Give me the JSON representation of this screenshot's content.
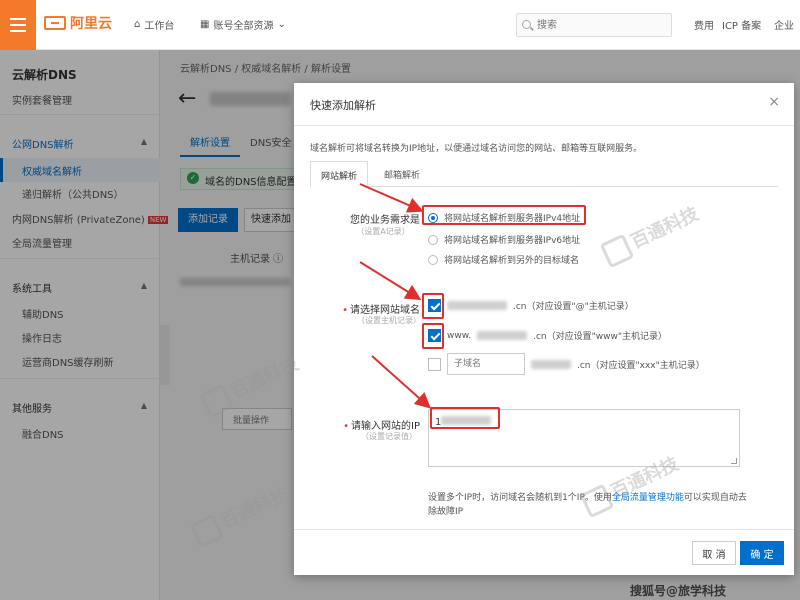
{
  "topbar": {
    "logo_text": "阿里云",
    "workbench": "工作台",
    "account_scope": "账号全部资源",
    "search_placeholder": "搜索",
    "links": [
      "费用",
      "ICP 备案",
      "企业"
    ]
  },
  "sidebar": {
    "title": "云解析DNS",
    "instance_mgmt": "实例套餐管理",
    "public_dns": "公网DNS解析",
    "authoritative": "权威域名解析",
    "recursive": "递归解析（公共DNS）",
    "private_zone": "内网DNS解析 (PrivateZone)",
    "new_badge": "NEW",
    "global_traffic": "全局流量管理",
    "system_tools": "系统工具",
    "assist_dns": "辅助DNS",
    "op_log": "操作日志",
    "cache_refresh": "运营商DNS缓存刷新",
    "other_services": "其他服务",
    "fusion_dns": "融合DNS"
  },
  "main": {
    "breadcrumb": "云解析DNS  /  权威域名解析  /  解析设置",
    "tab_settings": "解析设置",
    "tab_security": "DNS安全",
    "alert_text": "域名的DNS信息配置正",
    "add_record": "添加记录",
    "quick_add": "快速添加",
    "host_record": "主机记录 ⓘ",
    "batch_ops": "批量操作"
  },
  "modal": {
    "title": "快速添加解析",
    "description": "域名解析可将域名转换为IP地址，以便通过域名访问您的网站、邮箱等互联网服务。",
    "tabs": [
      "网站解析",
      "邮箱解析"
    ],
    "business_label": "您的业务需求是",
    "business_hint": "（设置A记录）",
    "business_options": [
      "将网站域名解析到服务器IPv4地址",
      "将网站域名解析到服务器IPv6地址",
      "将网站域名解析到另外的目标域名"
    ],
    "domain_label": "请选择网站域名",
    "domain_hint": "（设置主机记录）",
    "domain_root_suffix": ".cn（对应设置\"@\"主机记录）",
    "domain_www_prefix": "www.",
    "domain_www_suffix": ".cn（对应设置\"www\"主机记录）",
    "subdomain_placeholder": "子域名",
    "domain_custom_suffix": ".cn（对应设置\"xxx\"主机记录）",
    "ip_label": "请输入网站的IP",
    "ip_hint": "（设置记录值）",
    "ip_value_prefix": "1",
    "ip_note_before": "设置多个IP时，访问域名会随机到1个IP。使用",
    "ip_note_link": "全局流量管理功能",
    "ip_note_after": "可以实现自动去除故障IP",
    "cancel": "取 消",
    "ok": "确 定"
  },
  "watermark": {
    "brand": "百通科技",
    "footer": "搜狐号@旅学科技"
  },
  "colors": {
    "brand_orange": "#f27a2a",
    "primary_blue": "#0070cc",
    "highlight_red": "#e0302d"
  }
}
